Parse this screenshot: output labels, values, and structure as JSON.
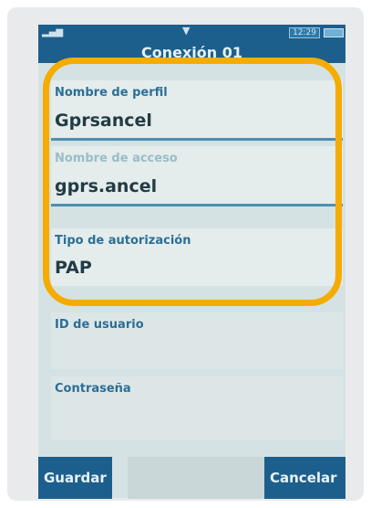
{
  "statusbar": {
    "signal_icon": "signal-bars-icon",
    "notification_icon": "arrow-down-icon",
    "clock": "12:29"
  },
  "title": "Conexión 01",
  "fields": {
    "profile_name": {
      "label": "Nombre de perfil",
      "value": "Gprsancel"
    },
    "access_name": {
      "label": "Nombre de acceso",
      "value": "gprs.ancel"
    },
    "auth_type": {
      "label": "Tipo de autorización",
      "value": "PAP"
    },
    "user_id": {
      "label": "ID de usuario",
      "value": ""
    },
    "password": {
      "label": "Contraseña",
      "value": ""
    }
  },
  "softkeys": {
    "save": "Guardar",
    "cancel": "Cancelar"
  },
  "colors": {
    "highlight": "#f5ab00",
    "header": "#1d5f8c",
    "label": "#2a6f97"
  }
}
